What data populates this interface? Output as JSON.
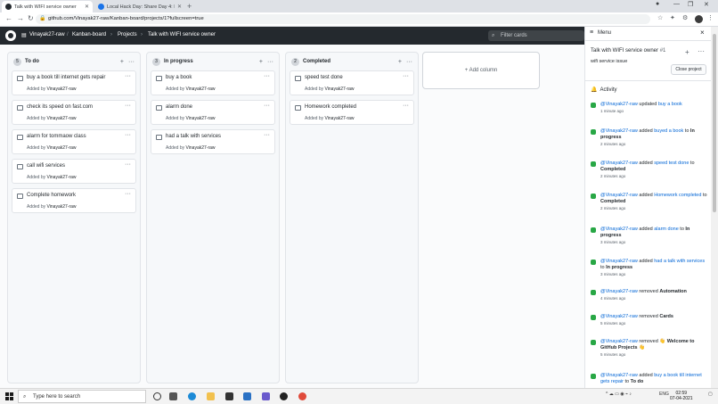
{
  "browser": {
    "tabs": [
      {
        "title": "Talk with WIFI service owner",
        "active": true
      },
      {
        "title": "Local Hack Day: Share Day 4: Lo",
        "active": false
      }
    ],
    "url": "github.com/Vinayak27-raw/Kanban-board/projects/1?fullscreen=true"
  },
  "header": {
    "owner": "Vinayak27-raw",
    "repo": "Kanban-board",
    "section": "Projects",
    "project": "Talk with WIFI service owner",
    "filter_placeholder": "Filter cards"
  },
  "board": {
    "columns": [
      {
        "count": "5",
        "title": "To do",
        "cards": [
          {
            "note": "buy a book till internet gets repair",
            "added_by": "Added by",
            "user": "Vinayak27-raw"
          },
          {
            "note": "check its speed on fast.com",
            "added_by": "Added by",
            "user": "Vinayak27-raw"
          },
          {
            "note": "alarm for tommaow class",
            "added_by": "Added by",
            "user": "Vinayak27-raw"
          },
          {
            "note": "call wifi services",
            "added_by": "Added by",
            "user": "Vinayak27-raw"
          },
          {
            "note": "Complete homework",
            "added_by": "Added by",
            "user": "Vinayak27-raw"
          }
        ]
      },
      {
        "count": "3",
        "title": "In progress",
        "cards": [
          {
            "note": "buy a book",
            "added_by": "Added by",
            "user": "Vinayak27-raw"
          },
          {
            "note": "alarm done",
            "added_by": "Added by",
            "user": "Vinayak27-raw"
          },
          {
            "note": "had a talk with services",
            "added_by": "Added by",
            "user": "Vinayak27-raw"
          }
        ]
      },
      {
        "count": "2",
        "title": "Completed",
        "cards": [
          {
            "note": "speed test done",
            "added_by": "Added by",
            "user": "Vinayak27-raw"
          },
          {
            "note": "Homework completed",
            "added_by": "Added by",
            "user": "Vinayak27-raw"
          }
        ]
      }
    ],
    "add_column_label": "+ Add column"
  },
  "sidemenu": {
    "title": "Menu",
    "project_title": "Talk with WIFI service owner",
    "project_number": "#1",
    "project_description": "wifi service issue",
    "close_project": "Close project",
    "activity_title": "Activity",
    "activity": [
      {
        "user": "@Vinayak27-raw",
        "action": " updated ",
        "item": "buy a book",
        "tail": "",
        "target": "",
        "time": "1 minute ago"
      },
      {
        "user": "@Vinayak27-raw",
        "action": " added ",
        "item": "buyed a book",
        "tail": " to ",
        "target": "In progress",
        "time": "2 minutes ago"
      },
      {
        "user": "@Vinayak27-raw",
        "action": " added ",
        "item": "speed test done",
        "tail": " to ",
        "target": "Completed",
        "time": "2 minutes ago"
      },
      {
        "user": "@Vinayak27-raw",
        "action": " added ",
        "item": "Homework completed",
        "tail": " to ",
        "target": "Completed",
        "time": "2 minutes ago"
      },
      {
        "user": "@Vinayak27-raw",
        "action": " added ",
        "item": "alarm done",
        "tail": " to ",
        "target": "In progress",
        "time": "3 minutes ago"
      },
      {
        "user": "@Vinayak27-raw",
        "action": " added ",
        "item": "had a talk with services",
        "tail": " to ",
        "target": "In progress",
        "time": "3 minutes ago"
      },
      {
        "user": "@Vinayak27-raw",
        "action": " removed ",
        "item": "",
        "tail": "",
        "target": "Automation",
        "time": "4 minutes ago"
      },
      {
        "user": "@Vinayak27-raw",
        "action": " removed ",
        "item": "",
        "tail": "",
        "target": "Cards",
        "time": "5 minutes ago"
      },
      {
        "user": "@Vinayak27-raw",
        "action": " removed ",
        "item": "",
        "tail": "",
        "target": "👋 Welcome to GitHub Projects 👋",
        "time": "5 minutes ago"
      },
      {
        "user": "@Vinayak27-raw",
        "action": " added ",
        "item": "buy a book till internet gets repair",
        "tail": " to ",
        "target": "To do",
        "time": ""
      }
    ]
  },
  "taskbar": {
    "search_placeholder": "Type here to search",
    "lang": "ENG",
    "time": "02:59",
    "date": "07-04-2021"
  }
}
